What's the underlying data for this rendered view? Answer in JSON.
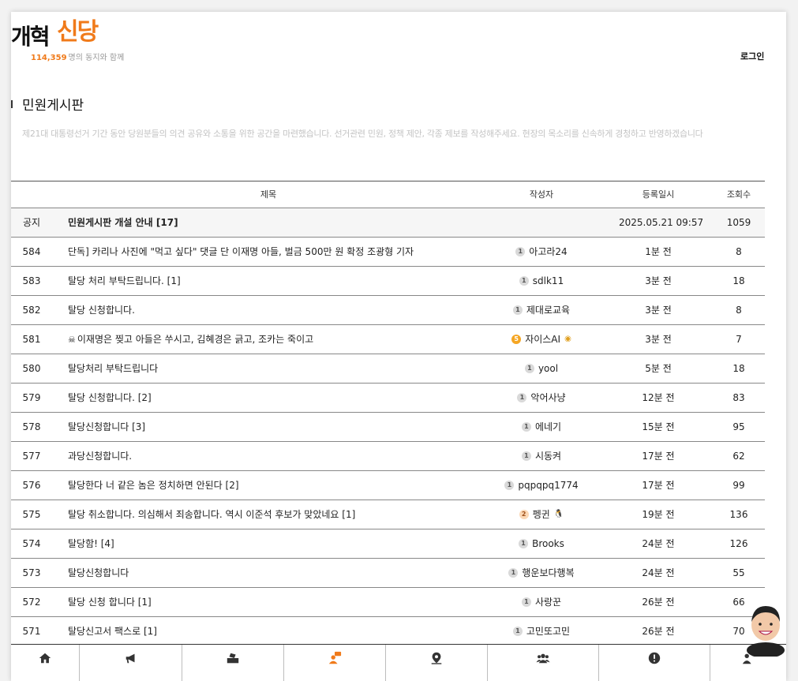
{
  "header": {
    "logo_main": "개혁",
    "logo_accent": "신당",
    "member_count": "114,359",
    "member_suffix": "명의 동지와 함께",
    "login_label": "로그인"
  },
  "board": {
    "title": "민원게시판",
    "description": "제21대 대통령선거 기간 동안 당원분들의 의견 공유와 소통을 위한 공간을 마련했습니다. 선거관련 민원, 정책 제안, 각종 제보를 작성해주세요. 현장의 목소리를 신속하게 경청하고 반영하겠습니다"
  },
  "table": {
    "headers": {
      "title": "제목",
      "author": "작성자",
      "date": "등록일시",
      "views": "조회수"
    },
    "notice": {
      "no": "공지",
      "title": "민원게시판 개설 안내 [17]",
      "author": "",
      "date": "2025.05.21 09:57",
      "views": "1059"
    },
    "rows": [
      {
        "no": "584",
        "title": "단독] 카리나 사진에 \"먹고 싶다\" 댓글 단 이재명 아들, 벌금 500만 원 확정 조광형 기자",
        "level": "1",
        "author": "아고라24",
        "date": "1분 전",
        "views": "8"
      },
      {
        "no": "583",
        "title": "탈당 처리 부탁드립니다. [1]",
        "level": "1",
        "author": "sdlk11",
        "date": "3분 전",
        "views": "18"
      },
      {
        "no": "582",
        "title": "탈당 신청합니다.",
        "level": "1",
        "author": "제대로교육",
        "date": "3분 전",
        "views": "8"
      },
      {
        "no": "581",
        "title": "이재명은 찢고 아들은 쑤시고, 김혜경은 긁고, 조카는 죽이고",
        "level": "5",
        "author": "자이스AI",
        "date": "3분 전",
        "views": "7"
      },
      {
        "no": "580",
        "title": "탈당처리 부탁드립니다",
        "level": "1",
        "author": "yool",
        "date": "5분 전",
        "views": "18"
      },
      {
        "no": "579",
        "title": "탈당 신청합니다. [2]",
        "level": "1",
        "author": "악어사냥",
        "date": "12분 전",
        "views": "83"
      },
      {
        "no": "578",
        "title": "탈당신청합니다 [3]",
        "level": "1",
        "author": "에네기",
        "date": "15분 전",
        "views": "95"
      },
      {
        "no": "577",
        "title": "과당신청합니다.",
        "level": "1",
        "author": "시동켜",
        "date": "17분 전",
        "views": "62"
      },
      {
        "no": "576",
        "title": "탈당한다 너 같은 놈은 정치하면 안된다 [2]",
        "level": "1",
        "author": "pqpqpq1774",
        "date": "17분 전",
        "views": "99"
      },
      {
        "no": "575",
        "title": "탈당 취소합니다. 의심해서 죄송합니다. 역시 이준석 후보가 맞았네요 [1]",
        "level": "2",
        "author": "펭귄",
        "date": "19분 전",
        "views": "136"
      },
      {
        "no": "574",
        "title": "탈당함! [4]",
        "level": "1",
        "author": "Brooks",
        "date": "24분 전",
        "views": "126"
      },
      {
        "no": "573",
        "title": "탈당신청합니다",
        "level": "1",
        "author": "행운보다행복",
        "date": "24분 전",
        "views": "55"
      },
      {
        "no": "572",
        "title": "탈당 신청 합니다 [1]",
        "level": "1",
        "author": "사랑꾼",
        "date": "26분 전",
        "views": "66"
      },
      {
        "no": "571",
        "title": "탈당신고서 팩스로 [1]",
        "level": "1",
        "author": "고민또고민",
        "date": "26분 전",
        "views": "70"
      }
    ]
  },
  "icons": {
    "row_581_prefix": "skull-icon",
    "row_581_badge": "medal-icon",
    "row_575_badge": "penguin-icon"
  },
  "nav": {
    "items": [
      {
        "icon": "home-icon"
      },
      {
        "icon": "megaphone-icon"
      },
      {
        "icon": "ballot-box-icon"
      },
      {
        "icon": "chat-person-icon",
        "active": true
      },
      {
        "icon": "map-pin-icon"
      },
      {
        "icon": "group-icon"
      },
      {
        "icon": "info-icon"
      },
      {
        "icon": "people-icon"
      }
    ]
  },
  "colors": {
    "accent": "#f07a1a",
    "text": "#222222",
    "muted": "#c4c4c4"
  }
}
